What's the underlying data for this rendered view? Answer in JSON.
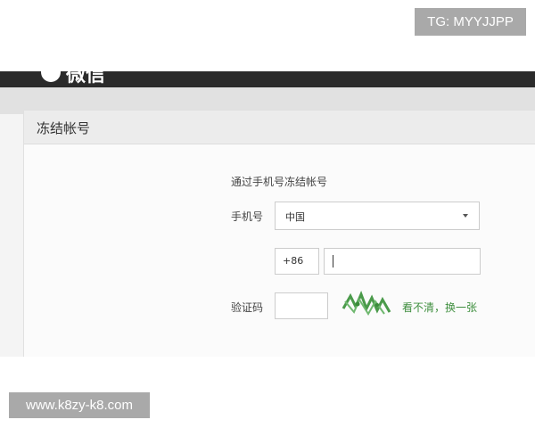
{
  "watermark_top": "TG: MYYJJPP",
  "watermark_bottom": "www.k8zy-k8.com",
  "app": {
    "brand_name": "微信"
  },
  "panel": {
    "title": "冻结帐号"
  },
  "form": {
    "heading": "通过手机号冻结帐号",
    "phone_label": "手机号",
    "country_value": "中国",
    "country_code": "+86",
    "phone_value": "",
    "captcha_label": "验证码",
    "captcha_value": "",
    "refresh_link": "看不清，换一张"
  },
  "colors": {
    "topbar": "#2b2b2b",
    "link_green": "#3f8f3f",
    "watermark_bg": "#a9a9a9"
  }
}
